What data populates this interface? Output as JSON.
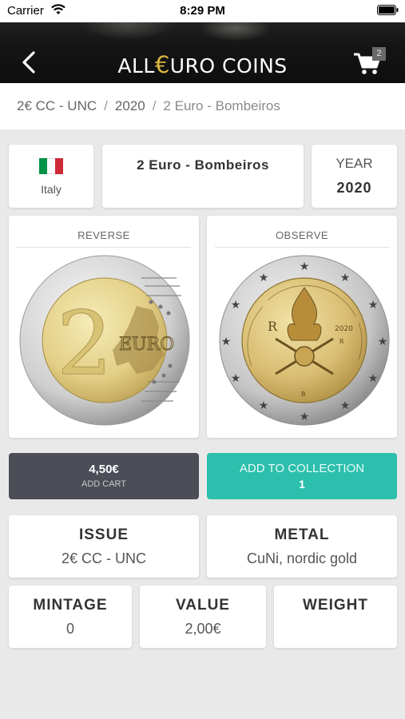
{
  "status_bar": {
    "carrier": "Carrier",
    "time": "8:29 PM",
    "icons": [
      "wifi-icon",
      "battery-icon"
    ]
  },
  "header": {
    "logo_prefix": "ALL",
    "logo_euro": "€",
    "logo_suffix": "URO COINS",
    "cart_count": "2",
    "icons": [
      "back-arrow-icon",
      "shopping-cart-icon"
    ]
  },
  "breadcrumb": {
    "items": [
      "2€ CC - UNC",
      "2020",
      "2 Euro - Bombeiros"
    ],
    "separator": "/"
  },
  "coin": {
    "country": "Italy",
    "flag_colors": [
      "#009246",
      "#ffffff",
      "#ce2b37"
    ],
    "name": "2 Euro - Bombeiros",
    "year_label": "YEAR",
    "year": "2020"
  },
  "images": {
    "reverse_title": "REVERSE",
    "observe_title": "OBSERVE"
  },
  "actions": {
    "price": "4,50€",
    "add_cart_label": "ADD CART",
    "add_collection_label": "ADD TO COLLECTION",
    "collection_count": "1"
  },
  "details": {
    "issue_label": "ISSUE",
    "issue_value": "2€ CC - UNC",
    "metal_label": "METAL",
    "metal_value": "CuNi, nordic gold",
    "mintage_label": "MINTAGE",
    "mintage_value": "0",
    "value_label": "VALUE",
    "value_value": "2,00€",
    "weight_label": "WEIGHT",
    "weight_value": ""
  },
  "colors": {
    "accent_teal": "#2dbfad",
    "dark_button": "#4b4e57",
    "logo_gold": "#d9b740"
  }
}
